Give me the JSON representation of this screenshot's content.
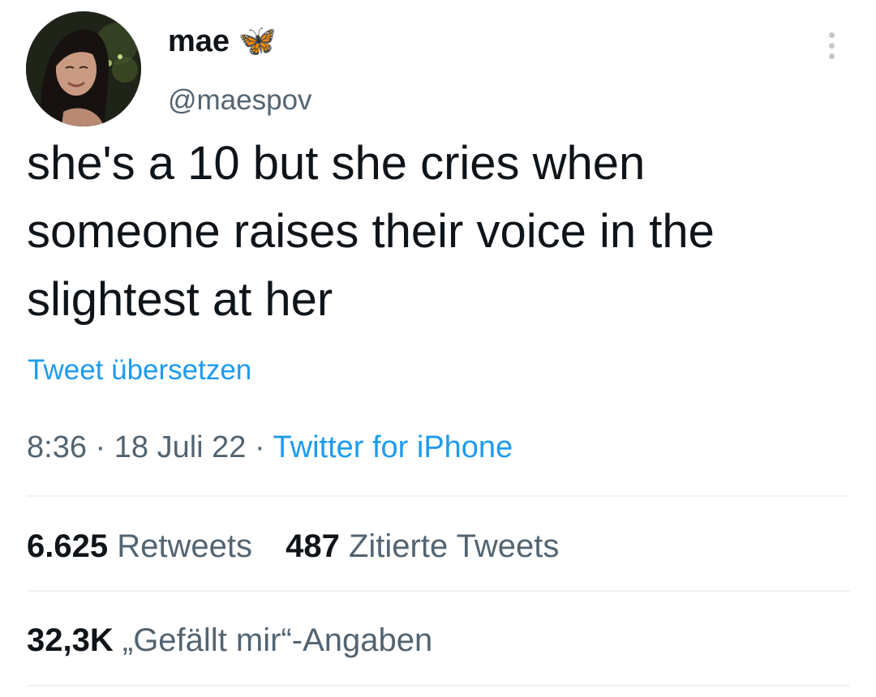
{
  "user": {
    "display_name": "mae 🦋",
    "handle": "@maespov"
  },
  "tweet": {
    "text_lines": [
      "she's a 10 but she cries when",
      "someone raises their voice in the",
      "slightest at her"
    ],
    "translate_label": "Tweet übersetzen",
    "time": "8:36",
    "separator": "·",
    "date": "18 Juli 22",
    "source": "Twitter for iPhone"
  },
  "stats": {
    "retweets_count": "6.625",
    "retweets_label": "Retweets",
    "quotes_count": "487",
    "quotes_label": "Zitierte Tweets",
    "likes_count": "32,3K",
    "likes_label": "„Gefällt mir“-Angaben"
  },
  "icons": {
    "more": "more-vertical-icon"
  },
  "colors": {
    "text_primary": "#0f1419",
    "text_secondary": "#536471",
    "link": "#1d9bf0",
    "divider": "#eff3f4"
  }
}
